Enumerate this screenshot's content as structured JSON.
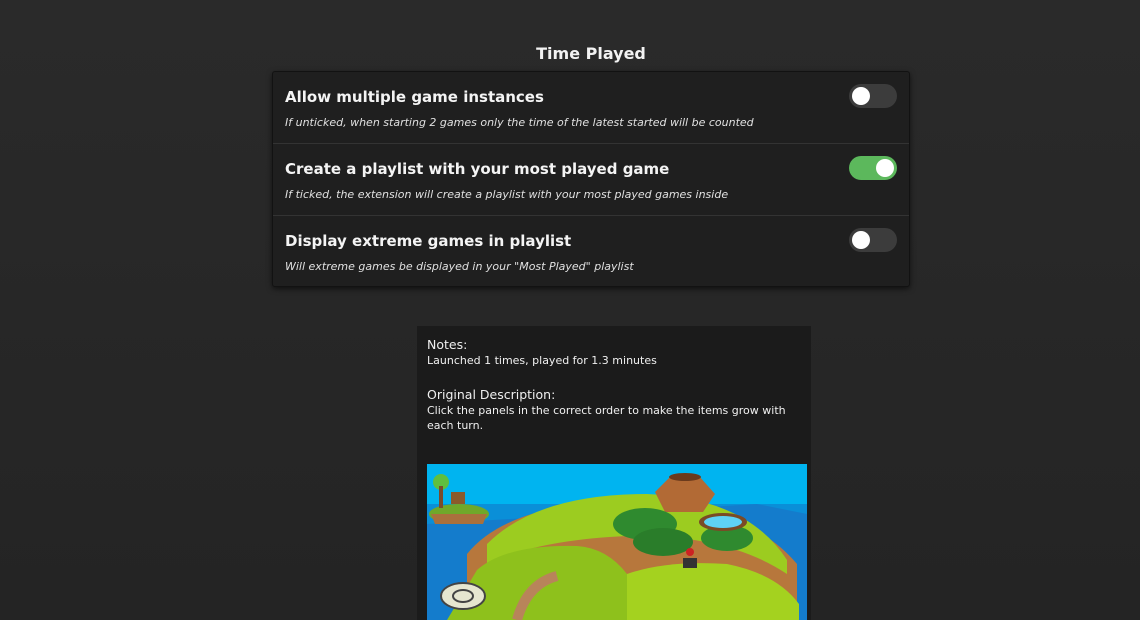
{
  "section": {
    "title": "Time Played"
  },
  "settings": [
    {
      "title": "Allow multiple game instances",
      "description": "If unticked, when starting 2 games only the time of the latest started will be counted",
      "enabled": false
    },
    {
      "title": "Create a playlist with your most played game",
      "description": "If ticked, the extension will create a playlist with your most played games inside",
      "enabled": true
    },
    {
      "title": "Display extreme games in playlist",
      "description": "Will extreme games be displayed in your \"Most Played\" playlist",
      "enabled": false
    }
  ],
  "notes": {
    "heading": "Notes:",
    "text": "Launched 1 times, played for 1.3 minutes",
    "original_heading": "Original Description:",
    "original_text": "Click the panels in the correct order to make the items grow with each turn."
  },
  "colors": {
    "background": "#262626",
    "card": "#1f1f1f",
    "toggle_on": "#5cb85c",
    "toggle_off": "#3c3c3c"
  }
}
